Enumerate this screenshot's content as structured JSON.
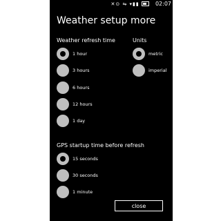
{
  "status_bar": {
    "icons": "✕⊙ ⇋ ▾▮▮",
    "time": "02:07"
  },
  "page": {
    "title": "Weather setup more"
  },
  "refresh": {
    "label": "Weather refresh time",
    "options": [
      "1 hour",
      "3 hours",
      "6 hours",
      "12 hours",
      "1 day"
    ],
    "selected": "1 hour"
  },
  "units": {
    "label": "Units",
    "options": [
      "metric",
      "imperial"
    ],
    "selected": "metric"
  },
  "gps": {
    "label": "GPS startup time before refresh",
    "options": [
      "15 seconds",
      "30 seconds",
      "1 minute"
    ],
    "selected": "15 seconds"
  },
  "actions": {
    "close_label": "close"
  },
  "colors": {
    "background": "#000000",
    "foreground": "#ffffff",
    "radio": "#bfbfbf"
  }
}
